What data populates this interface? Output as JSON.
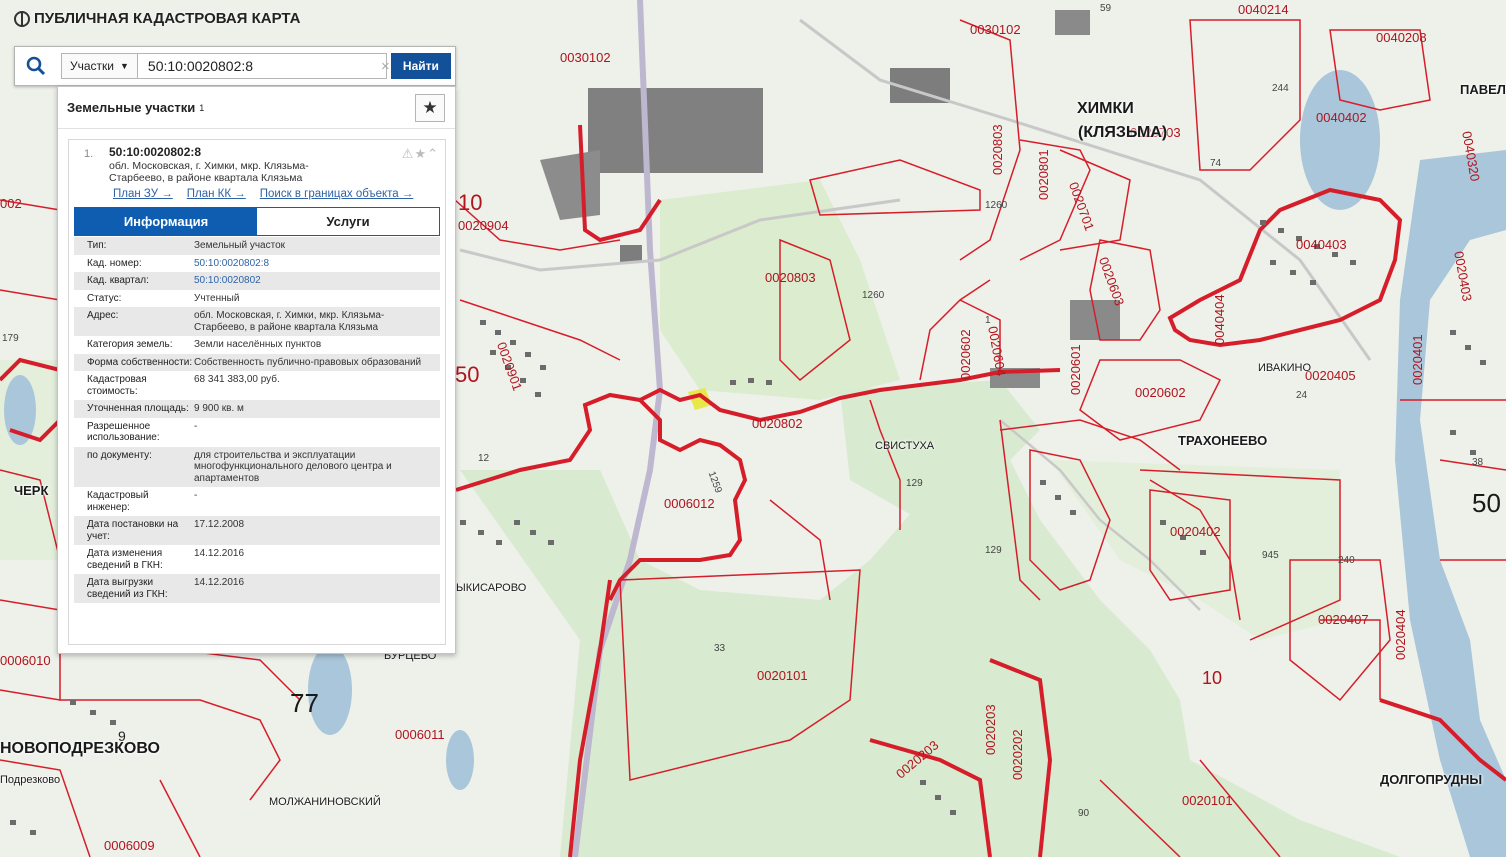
{
  "app": {
    "title": "ПУБЛИЧНАЯ КАДАСТРОВАЯ КАРТА"
  },
  "search": {
    "type_label": "Участки",
    "query": "50:10:0020802:8",
    "clear_glyph": "×",
    "button_label": "Найти"
  },
  "panel": {
    "header": "Земельные участки",
    "count": "1",
    "favorite_glyph": "★"
  },
  "result": {
    "number": "1.",
    "title": "50:10:0020802:8",
    "address": "обл. Московская, г. Химки, мкр. Клязьма-Старбеево, в районе квартала Клязьма",
    "icons": "⚠★⌃",
    "links": [
      "План ЗУ →",
      "План КК →",
      "Поиск в границах объекта →"
    ],
    "tabs": [
      "Информация",
      "Услуги"
    ],
    "attributes": [
      {
        "label": "Тип:",
        "value": "Земельный участок",
        "link": false
      },
      {
        "label": "Кад. номер:",
        "value": "50:10:0020802:8",
        "link": true
      },
      {
        "label": "Кад. квартал:",
        "value": "50:10:0020802",
        "link": true
      },
      {
        "label": "Статус:",
        "value": "Учтенный",
        "link": false
      },
      {
        "label": "Адрес:",
        "value": "обл. Московская, г. Химки, мкр. Клязьма-Старбеево, в районе квартала Клязьма",
        "link": false
      },
      {
        "label": "Категория земель:",
        "value": "Земли населённых пунктов",
        "link": false
      },
      {
        "label": "Форма собственности:",
        "value": "Собственность публично-правовых образований",
        "link": false
      },
      {
        "label": "Кадастровая стоимость:",
        "value": "68 341 383,00 руб.",
        "link": false
      },
      {
        "label": "Уточненная площадь:",
        "value": "9 900 кв. м",
        "link": false
      },
      {
        "label": "Разрешенное использование:",
        "value": "-",
        "link": false
      },
      {
        "label": "по документу:",
        "value": "для строительства и эксплуатации многофункционального делового центра и апартаментов",
        "link": false
      },
      {
        "label": "Кадастровый инженер:",
        "value": "-",
        "link": false
      },
      {
        "label": "Дата постановки на учет:",
        "value": "17.12.2008",
        "link": false
      },
      {
        "label": "Дата изменения сведений в ГКН:",
        "value": "14.12.2016",
        "link": false
      },
      {
        "label": "Дата выгрузки сведений из ГКН:",
        "value": "14.12.2016",
        "link": false
      }
    ]
  },
  "map": {
    "places": [
      "ХИМКИ",
      "(КЛЯЗЬМА)",
      "ТРАХОНЕЕВО",
      "ИВАКИНО",
      "СВИСТУХА",
      "ДОЛГОПРУДНЫ",
      "НОВОПОДРЕЗКОВО",
      "МОЛЖАНИНОВСКИЙ",
      "БУРЦЕВО",
      "ЧЕРК",
      "ПАВЕЛ",
      "ЫКИСАРОВО",
      "Подрезково"
    ],
    "cadastral_labels": [
      "0030102",
      "0030102",
      "0020904",
      "0020803",
      "0020803",
      "0020801",
      "0020701",
      "0020703",
      "0020603",
      "0020602",
      "0020604",
      "0020601",
      "0020602",
      "0020802",
      "0006012",
      "0020402",
      "0020405",
      "0020401",
      "0040403",
      "0040404",
      "0040402",
      "0040208",
      "0040214",
      "0040320",
      "0020101",
      "0020101",
      "0020203",
      "0020202",
      "0020203",
      "0006011",
      "0006009",
      "0006010",
      "0020407",
      "0020404",
      "0020901",
      "002",
      "0020403"
    ],
    "number_labels": [
      "59",
      "244",
      "74",
      "1260",
      "1260",
      "10",
      "50",
      "77",
      "10",
      "50",
      "129",
      "129",
      "945",
      "240",
      "33",
      "90",
      "24",
      "38",
      "179",
      "12",
      "9",
      "1",
      "1259"
    ],
    "colors": {
      "boundary": "#d61e2a",
      "forest": "#d8ead0",
      "background": "#eef0ea",
      "building": "#808080",
      "water": "#a9c6da"
    }
  }
}
